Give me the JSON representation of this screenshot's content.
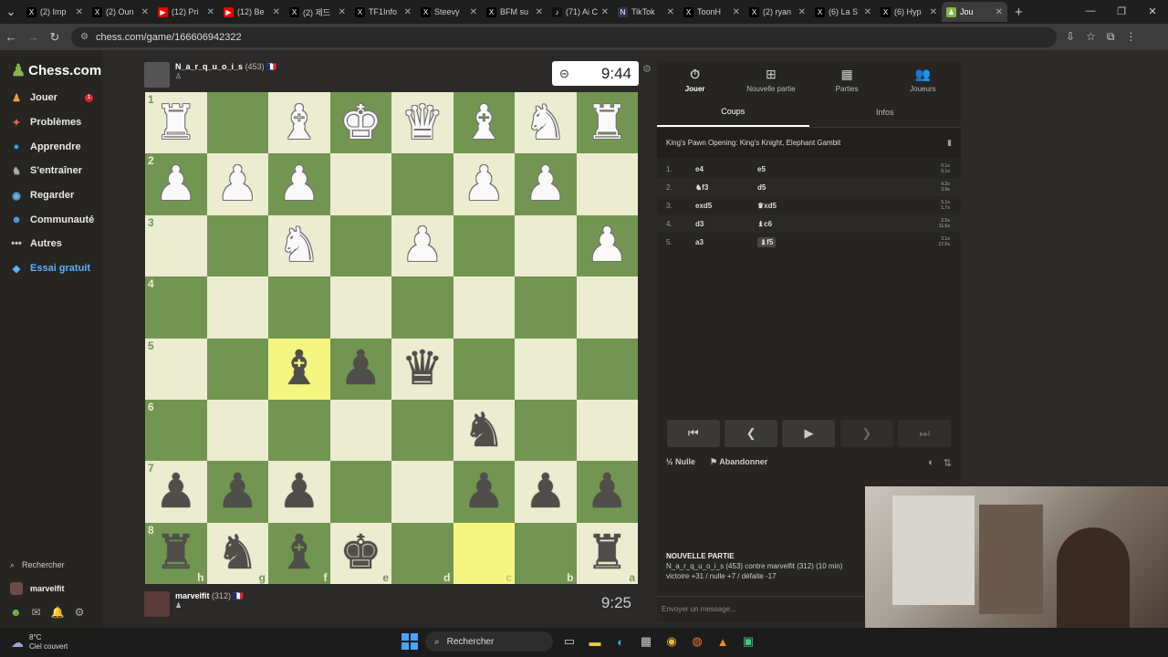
{
  "browser": {
    "tabs": [
      {
        "icon": "X",
        "title": "(2) Imp",
        "color": "#000"
      },
      {
        "icon": "X",
        "title": "(2) Oun",
        "color": "#000"
      },
      {
        "icon": "▶",
        "title": "(12) Pri",
        "color": "#e00"
      },
      {
        "icon": "▶",
        "title": "(12) Be",
        "color": "#e00"
      },
      {
        "icon": "X",
        "title": "(2) 제드",
        "color": "#000"
      },
      {
        "icon": "X",
        "title": "TF1Info",
        "color": "#000"
      },
      {
        "icon": "X",
        "title": "Steevy",
        "color": "#000"
      },
      {
        "icon": "X",
        "title": "BFM su",
        "color": "#000"
      },
      {
        "icon": "♪",
        "title": "(71) Ai C",
        "color": "#111"
      },
      {
        "icon": "N",
        "title": "TikTok",
        "color": "#335"
      },
      {
        "icon": "X",
        "title": "ToonH",
        "color": "#000"
      },
      {
        "icon": "X",
        "title": "(2) ryan",
        "color": "#000"
      },
      {
        "icon": "X",
        "title": "(6) La S",
        "color": "#000"
      },
      {
        "icon": "X",
        "title": "(6) Hyp",
        "color": "#000"
      },
      {
        "icon": "♟",
        "title": "Jou",
        "color": "#81b64c",
        "active": true
      }
    ],
    "new_tab": "+",
    "url": "chess.com/game/166606942322"
  },
  "sidebar": {
    "logo": "Chess.com",
    "items": [
      {
        "label": "Jouer",
        "icon": "♟",
        "color": "#e8a13a",
        "badge": "1"
      },
      {
        "label": "Problèmes",
        "icon": "✦",
        "color": "#e36b3b"
      },
      {
        "label": "Apprendre",
        "icon": "●",
        "color": "#3aa0e8"
      },
      {
        "label": "S'entraîner",
        "icon": "♞",
        "color": "#aaa"
      },
      {
        "label": "Regarder",
        "icon": "◉",
        "color": "#6ab0e8"
      },
      {
        "label": "Communauté",
        "icon": "☻",
        "color": "#5c9ee8"
      },
      {
        "label": "Autres",
        "icon": "•••",
        "color": "#ccc"
      },
      {
        "label": "Essai gratuit",
        "icon": "◆",
        "color": "#5cb0ff",
        "trial": true
      }
    ],
    "search": "Rechercher",
    "user": "marvelfit",
    "notif_badge": "4"
  },
  "top_player": {
    "name": "N_a_r_q_u_o_i_s",
    "rating": "(453)",
    "flag": "🇫🇷",
    "clock": "9:44"
  },
  "bottom_player": {
    "name": "marvelfit",
    "rating": "(312)",
    "flag": "🇫🇷",
    "clock": "9:25"
  },
  "board": {
    "ranks": [
      "1",
      "2",
      "3",
      "4",
      "5",
      "6",
      "7",
      "8"
    ],
    "files": [
      "h",
      "g",
      "f",
      "e",
      "d",
      "c",
      "b",
      "a"
    ],
    "rows": [
      [
        "wR",
        "",
        "wB",
        "wK",
        "wQ",
        "wB",
        "wN",
        "wR"
      ],
      [
        "wP",
        "wP",
        "wP",
        "",
        "",
        "wP",
        "wP",
        ""
      ],
      [
        "",
        "",
        "wN",
        "",
        "wP",
        "",
        "",
        "wP"
      ],
      [
        "",
        "",
        "",
        "",
        "",
        "",
        "",
        ""
      ],
      [
        "",
        "",
        "bB",
        "bP",
        "bQ",
        "",
        "",
        ""
      ],
      [
        "",
        "",
        "",
        "",
        "",
        "bN",
        "",
        ""
      ],
      [
        "bP",
        "bP",
        "bP",
        "",
        "",
        "bP",
        "bP",
        "bP"
      ],
      [
        "bR",
        "bN",
        "bB",
        "bK",
        "",
        "",
        "",
        "bR"
      ]
    ],
    "highlights": [
      "4-2",
      "7-5"
    ]
  },
  "panel": {
    "tabs": [
      {
        "label": "Jouer",
        "icon": "⏱",
        "active": true
      },
      {
        "label": "Nouvelle partie",
        "icon": "⊞"
      },
      {
        "label": "Parties",
        "icon": "▦"
      },
      {
        "label": "Joueurs",
        "icon": "👥"
      }
    ],
    "subtabs": [
      "Coups",
      "Infos"
    ],
    "opening": "King's Pawn Opening: King's Knight, Elephant Gambit",
    "moves": [
      {
        "n": "1.",
        "w": "e4",
        "b": "e5",
        "t": [
          "0.1s",
          "0.1s"
        ]
      },
      {
        "n": "2.",
        "w": "♞f3",
        "b": "d5",
        "t": [
          "4.2s",
          "3.9s"
        ]
      },
      {
        "n": "3.",
        "w": "exd5",
        "b": "♛xd5",
        "t": [
          "5.1s",
          "1.7s"
        ]
      },
      {
        "n": "4.",
        "w": "d3",
        "b": "♝c6",
        "t": [
          "2.5s",
          "11.6s"
        ]
      },
      {
        "n": "5.",
        "w": "a3",
        "b": "♝f5",
        "t": [
          "3.1s",
          "17.5s"
        ],
        "current": true
      }
    ],
    "draw": "½ Nulle",
    "resign": "Abandonner",
    "new_game_title": "NOUVELLE PARTIE",
    "new_game_line1": "N_a_r_q_u_o_i_s (453) contre marvelfit (312) (10 min)",
    "new_game_line2": "victoire +31 / nulle +7 / défaite -17",
    "chat_placeholder": "Envoyer un message..."
  },
  "taskbar": {
    "temp": "8°C",
    "weather": "Ciel couvert",
    "search": "Rechercher"
  }
}
